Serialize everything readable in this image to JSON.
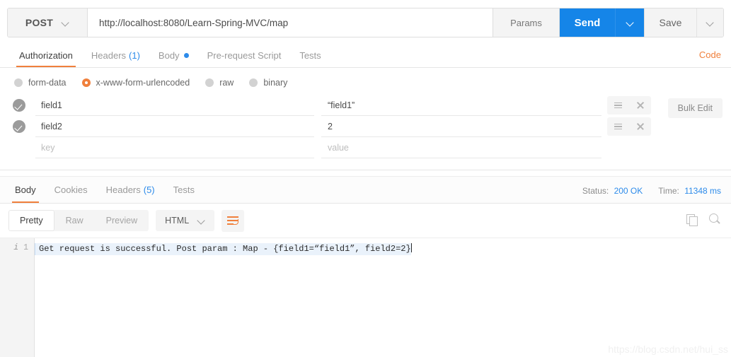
{
  "request": {
    "method": "POST",
    "url": "http://localhost:8080/Learn-Spring-MVC/map",
    "params_label": "Params",
    "send_label": "Send",
    "save_label": "Save",
    "tabs": [
      {
        "label": "Authorization",
        "count": "",
        "active": false,
        "dot": false
      },
      {
        "label": "Headers",
        "count": "(1)",
        "active": false,
        "dot": false
      },
      {
        "label": "Body",
        "count": "",
        "active": true,
        "dot": true
      },
      {
        "label": "Pre-request Script",
        "count": "",
        "active": false,
        "dot": false
      },
      {
        "label": "Tests",
        "count": "",
        "active": false,
        "dot": false
      }
    ],
    "code_link": "Code",
    "body_types": [
      {
        "label": "form-data",
        "selected": false
      },
      {
        "label": "x-www-form-urlencoded",
        "selected": true
      },
      {
        "label": "raw",
        "selected": false
      },
      {
        "label": "binary",
        "selected": false
      }
    ],
    "bulk_edit_label": "Bulk Edit",
    "params_table": {
      "key_placeholder": "key",
      "value_placeholder": "value",
      "rows": [
        {
          "checked": true,
          "key": "field1",
          "value": "“field1”"
        },
        {
          "checked": true,
          "key": "field2",
          "value": "2"
        },
        {
          "checked": false,
          "key": "",
          "value": ""
        }
      ]
    }
  },
  "response": {
    "tabs": [
      {
        "label": "Body",
        "count": "",
        "active": true
      },
      {
        "label": "Cookies",
        "count": "",
        "active": false
      },
      {
        "label": "Headers",
        "count": "(5)",
        "active": false
      },
      {
        "label": "Tests",
        "count": "",
        "active": false
      }
    ],
    "status_label": "Status:",
    "status_value": "200 OK",
    "time_label": "Time:",
    "time_value": "11348 ms",
    "view_modes": [
      {
        "label": "Pretty",
        "active": true
      },
      {
        "label": "Raw",
        "active": false
      },
      {
        "label": "Preview",
        "active": false
      }
    ],
    "format": "HTML",
    "gutter_line_number": "1",
    "gutter_info_icon": "i",
    "body_text": "Get request is successful. Post param : Map - {field1=“field1”, field2=2}"
  },
  "watermark": "https://blog.csdn.net/hui_ss",
  "colors": {
    "accent_orange": "#f0803c",
    "accent_blue": "#1585e8",
    "link_blue": "#2d8bea"
  }
}
